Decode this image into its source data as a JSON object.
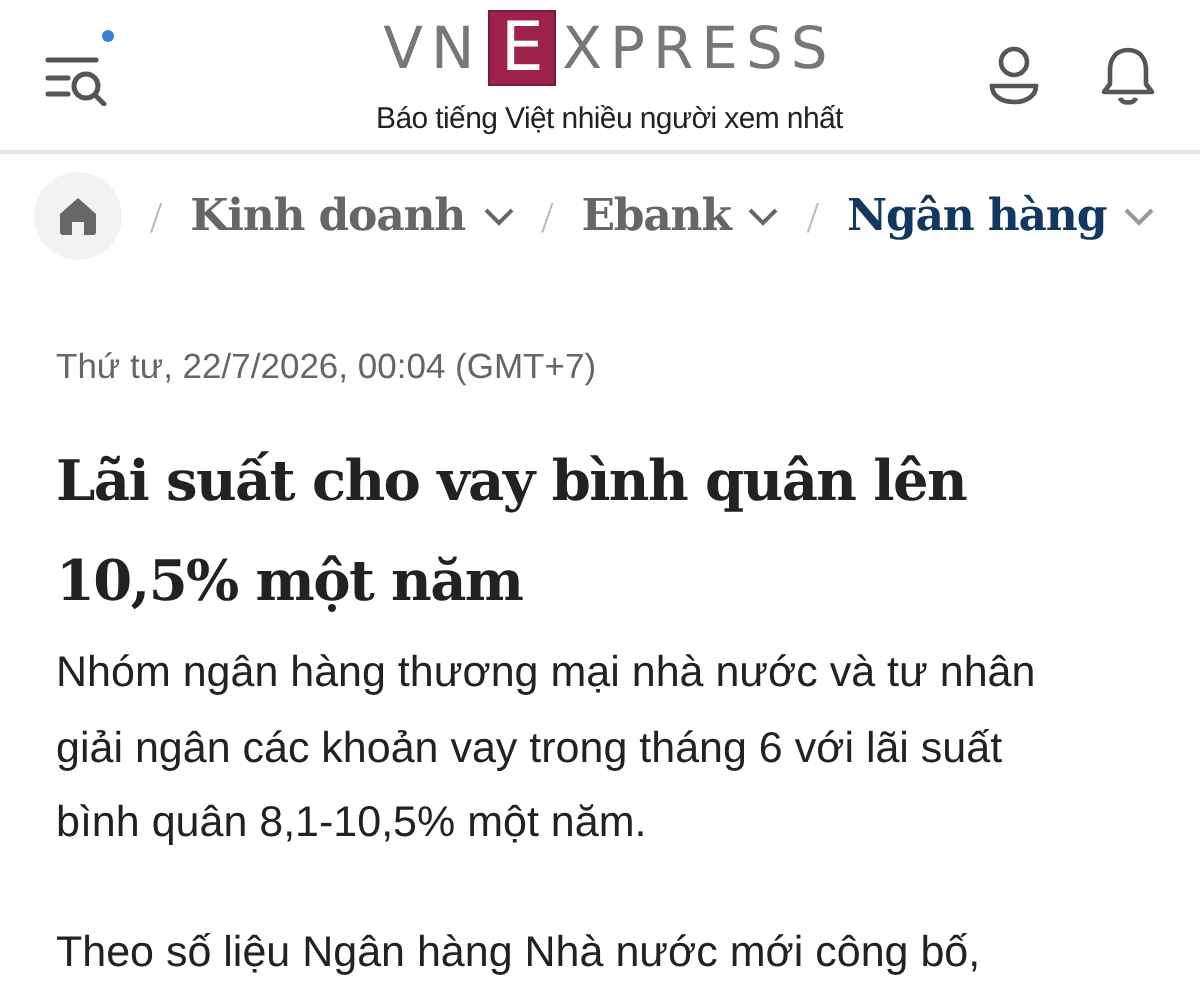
{
  "header": {
    "logo": {
      "before": "VN",
      "boxed": "E",
      "after": "XPRESS"
    },
    "tagline": "Báo tiếng Việt nhiều người xem nhất",
    "menu_notification": true
  },
  "breadcrumb": [
    {
      "separator": "/",
      "label": "Kinh doanh",
      "selected": false
    },
    {
      "separator": "/",
      "label": "Ebank",
      "selected": false
    },
    {
      "separator": "/",
      "label": "Ngân hàng",
      "selected": true
    }
  ],
  "article": {
    "date": "Thứ tư, 22/7/2026, 00:04 (GMT+7)",
    "title": "Lãi suất cho vay bình quân lên 10,5% một năm",
    "lead": "Nhóm ngân hàng thương mại nhà nước và tư nhân giải ngân các khoản vay trong tháng 6 với lãi suất bình quân 8,1-10,5% một năm.",
    "paragraphs": [
      "Theo số liệu Ngân hàng Nhà nước mới công bố,"
    ]
  }
}
